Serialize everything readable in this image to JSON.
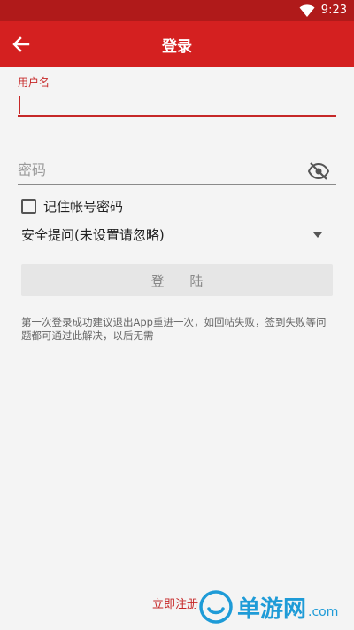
{
  "status_bar": {
    "time": "9:23",
    "wifi_icon": "wifi-icon"
  },
  "app_bar": {
    "title": "登录",
    "back_icon": "arrow-left-icon"
  },
  "form": {
    "username_label": "用户名",
    "username_value": "",
    "password_placeholder": "密码",
    "password_value": "",
    "visibility_icon": "eye-off-icon",
    "remember_label": "记住帐号密码",
    "remember_checked": false,
    "security_question_selected": "安全提问(未设置请忽略)",
    "login_button": "登 陆",
    "hint": "第一次登录成功建议退出App重进一次，如回帖失败，签到失败等问题都可通过此解决，以后无需"
  },
  "footer": {
    "register_link": "立即注册"
  },
  "watermark": {
    "text": "单游网",
    "suffix": ".com"
  },
  "colors": {
    "primary": "#d42020",
    "status": "#b01a1a",
    "accent": "#c62828",
    "watermark": "#1e9bd7"
  }
}
